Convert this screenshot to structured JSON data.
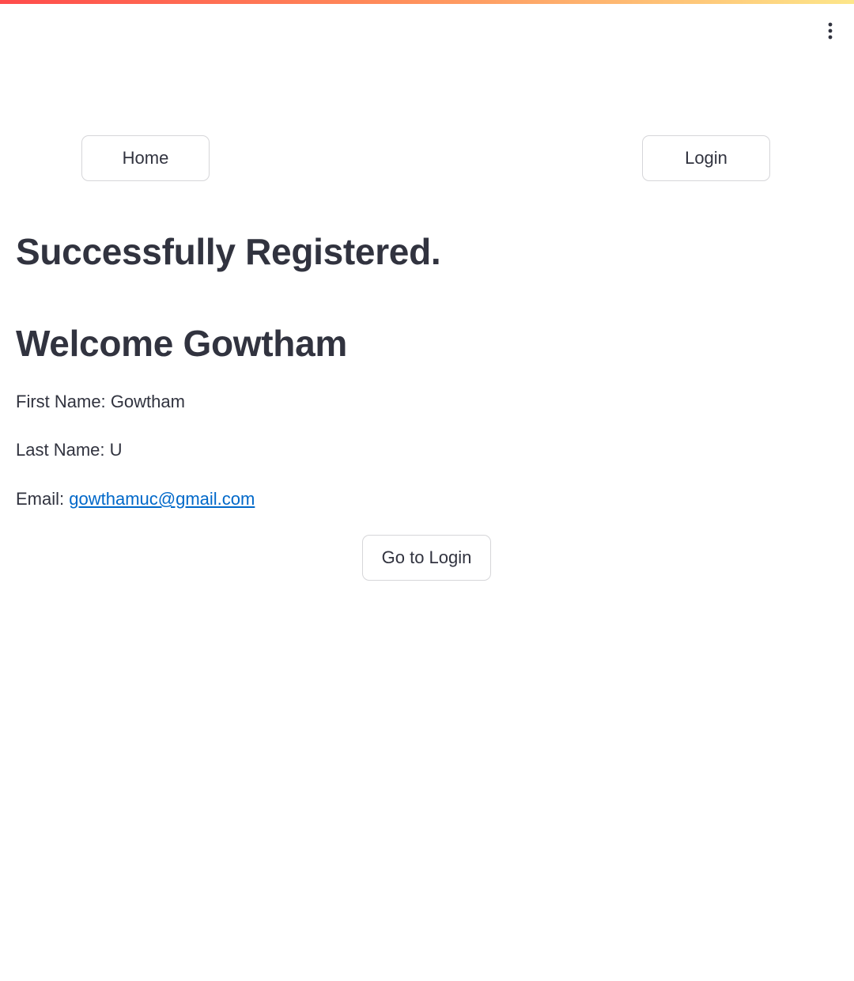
{
  "header": {
    "menu_icon": "vertical-ellipsis-icon",
    "decoration_colors": [
      "#ff4b4b",
      "#ff8c5a",
      "#fde68a"
    ]
  },
  "nav": {
    "home_label": "Home",
    "login_label": "Login"
  },
  "main": {
    "title": "Successfully Registered.",
    "welcome": "Welcome Gowtham",
    "first_name_label": "First Name:",
    "first_name_value": "Gowtham",
    "last_name_label": "Last Name:",
    "last_name_value": "U",
    "email_label": "Email:",
    "email_value": "gowthamuc@gmail.com",
    "go_to_login_label": "Go to Login"
  },
  "colors": {
    "text": "#31333f",
    "link": "#0068c9",
    "border": "rgba(49, 51, 63, 0.2)"
  }
}
